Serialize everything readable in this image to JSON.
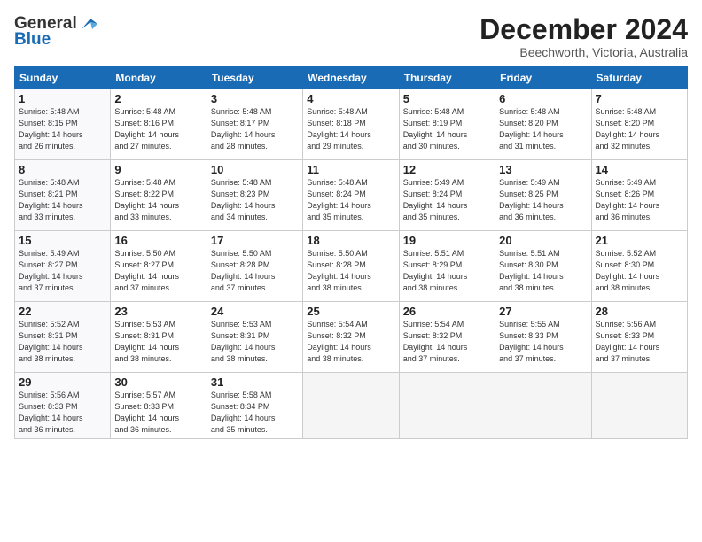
{
  "header": {
    "logo_general": "General",
    "logo_blue": "Blue",
    "month_title": "December 2024",
    "location": "Beechworth, Victoria, Australia"
  },
  "weekdays": [
    "Sunday",
    "Monday",
    "Tuesday",
    "Wednesday",
    "Thursday",
    "Friday",
    "Saturday"
  ],
  "weeks": [
    [
      {
        "day": 1,
        "info": "Sunrise: 5:48 AM\nSunset: 8:15 PM\nDaylight: 14 hours\nand 26 minutes."
      },
      {
        "day": 2,
        "info": "Sunrise: 5:48 AM\nSunset: 8:16 PM\nDaylight: 14 hours\nand 27 minutes."
      },
      {
        "day": 3,
        "info": "Sunrise: 5:48 AM\nSunset: 8:17 PM\nDaylight: 14 hours\nand 28 minutes."
      },
      {
        "day": 4,
        "info": "Sunrise: 5:48 AM\nSunset: 8:18 PM\nDaylight: 14 hours\nand 29 minutes."
      },
      {
        "day": 5,
        "info": "Sunrise: 5:48 AM\nSunset: 8:19 PM\nDaylight: 14 hours\nand 30 minutes."
      },
      {
        "day": 6,
        "info": "Sunrise: 5:48 AM\nSunset: 8:20 PM\nDaylight: 14 hours\nand 31 minutes."
      },
      {
        "day": 7,
        "info": "Sunrise: 5:48 AM\nSunset: 8:20 PM\nDaylight: 14 hours\nand 32 minutes."
      }
    ],
    [
      {
        "day": 8,
        "info": "Sunrise: 5:48 AM\nSunset: 8:21 PM\nDaylight: 14 hours\nand 33 minutes."
      },
      {
        "day": 9,
        "info": "Sunrise: 5:48 AM\nSunset: 8:22 PM\nDaylight: 14 hours\nand 33 minutes."
      },
      {
        "day": 10,
        "info": "Sunrise: 5:48 AM\nSunset: 8:23 PM\nDaylight: 14 hours\nand 34 minutes."
      },
      {
        "day": 11,
        "info": "Sunrise: 5:48 AM\nSunset: 8:24 PM\nDaylight: 14 hours\nand 35 minutes."
      },
      {
        "day": 12,
        "info": "Sunrise: 5:49 AM\nSunset: 8:24 PM\nDaylight: 14 hours\nand 35 minutes."
      },
      {
        "day": 13,
        "info": "Sunrise: 5:49 AM\nSunset: 8:25 PM\nDaylight: 14 hours\nand 36 minutes."
      },
      {
        "day": 14,
        "info": "Sunrise: 5:49 AM\nSunset: 8:26 PM\nDaylight: 14 hours\nand 36 minutes."
      }
    ],
    [
      {
        "day": 15,
        "info": "Sunrise: 5:49 AM\nSunset: 8:27 PM\nDaylight: 14 hours\nand 37 minutes."
      },
      {
        "day": 16,
        "info": "Sunrise: 5:50 AM\nSunset: 8:27 PM\nDaylight: 14 hours\nand 37 minutes."
      },
      {
        "day": 17,
        "info": "Sunrise: 5:50 AM\nSunset: 8:28 PM\nDaylight: 14 hours\nand 37 minutes."
      },
      {
        "day": 18,
        "info": "Sunrise: 5:50 AM\nSunset: 8:28 PM\nDaylight: 14 hours\nand 38 minutes."
      },
      {
        "day": 19,
        "info": "Sunrise: 5:51 AM\nSunset: 8:29 PM\nDaylight: 14 hours\nand 38 minutes."
      },
      {
        "day": 20,
        "info": "Sunrise: 5:51 AM\nSunset: 8:30 PM\nDaylight: 14 hours\nand 38 minutes."
      },
      {
        "day": 21,
        "info": "Sunrise: 5:52 AM\nSunset: 8:30 PM\nDaylight: 14 hours\nand 38 minutes."
      }
    ],
    [
      {
        "day": 22,
        "info": "Sunrise: 5:52 AM\nSunset: 8:31 PM\nDaylight: 14 hours\nand 38 minutes."
      },
      {
        "day": 23,
        "info": "Sunrise: 5:53 AM\nSunset: 8:31 PM\nDaylight: 14 hours\nand 38 minutes."
      },
      {
        "day": 24,
        "info": "Sunrise: 5:53 AM\nSunset: 8:31 PM\nDaylight: 14 hours\nand 38 minutes."
      },
      {
        "day": 25,
        "info": "Sunrise: 5:54 AM\nSunset: 8:32 PM\nDaylight: 14 hours\nand 38 minutes."
      },
      {
        "day": 26,
        "info": "Sunrise: 5:54 AM\nSunset: 8:32 PM\nDaylight: 14 hours\nand 37 minutes."
      },
      {
        "day": 27,
        "info": "Sunrise: 5:55 AM\nSunset: 8:33 PM\nDaylight: 14 hours\nand 37 minutes."
      },
      {
        "day": 28,
        "info": "Sunrise: 5:56 AM\nSunset: 8:33 PM\nDaylight: 14 hours\nand 37 minutes."
      }
    ],
    [
      {
        "day": 29,
        "info": "Sunrise: 5:56 AM\nSunset: 8:33 PM\nDaylight: 14 hours\nand 36 minutes."
      },
      {
        "day": 30,
        "info": "Sunrise: 5:57 AM\nSunset: 8:33 PM\nDaylight: 14 hours\nand 36 minutes."
      },
      {
        "day": 31,
        "info": "Sunrise: 5:58 AM\nSunset: 8:34 PM\nDaylight: 14 hours\nand 35 minutes."
      },
      null,
      null,
      null,
      null
    ]
  ]
}
